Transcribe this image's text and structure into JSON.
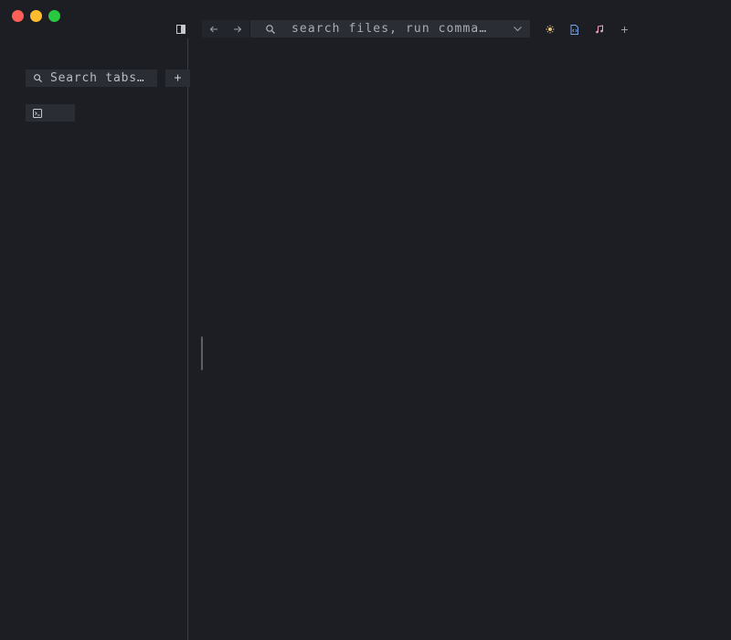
{
  "toolbar": {
    "sidebar_toggle_icon": "sidebar-toggle-icon",
    "back_icon": "arrow-left-icon",
    "forward_icon": "arrow-right-icon",
    "command_bar": {
      "placeholder": "search files, run comma…",
      "search_icon": "search-icon",
      "dropdown_icon": "chevron-down-icon"
    },
    "right_icons": [
      "sun-icon",
      "file-code-icon",
      "music-note-icon",
      "plus-icon"
    ]
  },
  "sidebar": {
    "search": {
      "placeholder": "Search tabs…",
      "search_icon": "search-icon"
    },
    "add_tab_label": "+",
    "tabs": [
      {
        "icon": "terminal-icon",
        "label": ""
      }
    ]
  },
  "colors": {
    "background": "#1c1e23",
    "panel": "#2a2d34",
    "close": "#fe5f57",
    "minimize": "#febc2e",
    "maximize": "#28c840"
  }
}
